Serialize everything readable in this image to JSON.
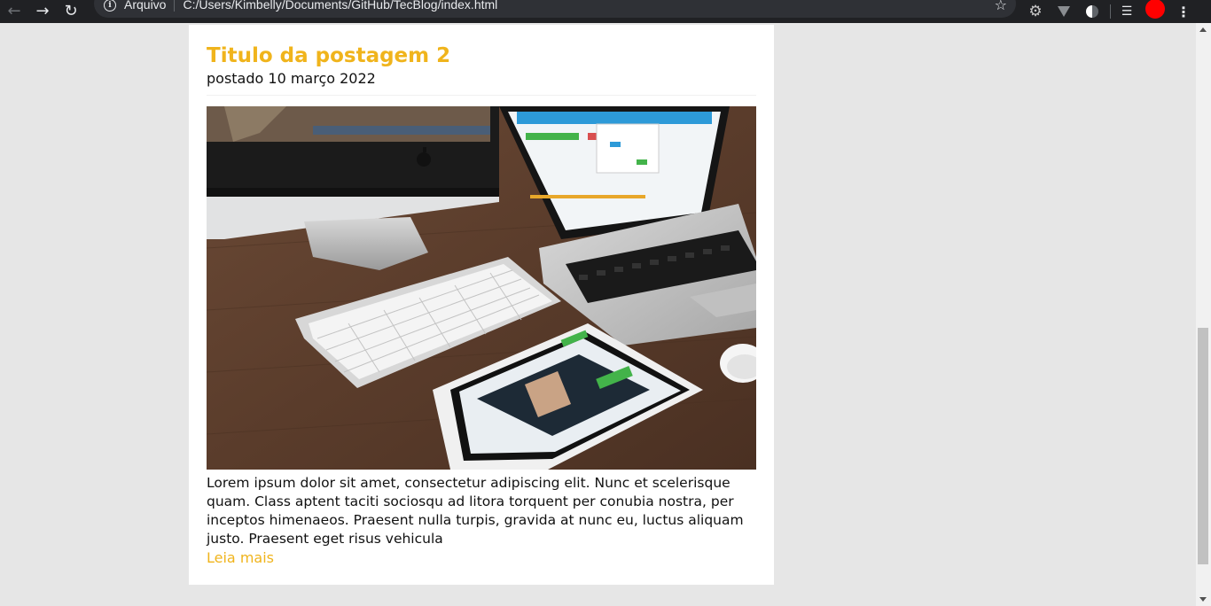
{
  "browser": {
    "back_icon": "arrow-left-icon",
    "forward_icon": "arrow-right-icon",
    "reload_icon": "reload-icon",
    "site_info_label": "Arquivo",
    "url": "C:/Users/Kimbelly/Documents/GitHub/TecBlog/index.html",
    "bookmark_icon": "star-icon",
    "extensions": [
      "gear-icon",
      "vpn-icon",
      "dark-mode-icon",
      "media-queue-icon"
    ],
    "profile_color": "#ff0000",
    "menu_icon": "more-vert-icon"
  },
  "post": {
    "title": "Titulo da postagem 2",
    "date": "postado 10 março 2022",
    "excerpt": "Lorem ipsum dolor sit amet, consectetur adipiscing elit. Nunc et scelerisque quam. Class aptent taciti sociosqu ad litora torquent per conubia nostra, per inceptos himenaeos. Praesent nulla turpis, gravida at nunc eu, luctus aliquam justo. Praesent eget risus vehicula",
    "read_more": "Leia mais"
  },
  "colors": {
    "accent": "#f0b41c",
    "page_background": "#e6e6e6",
    "card_background": "#ffffff",
    "toolbar_background": "#202124"
  }
}
